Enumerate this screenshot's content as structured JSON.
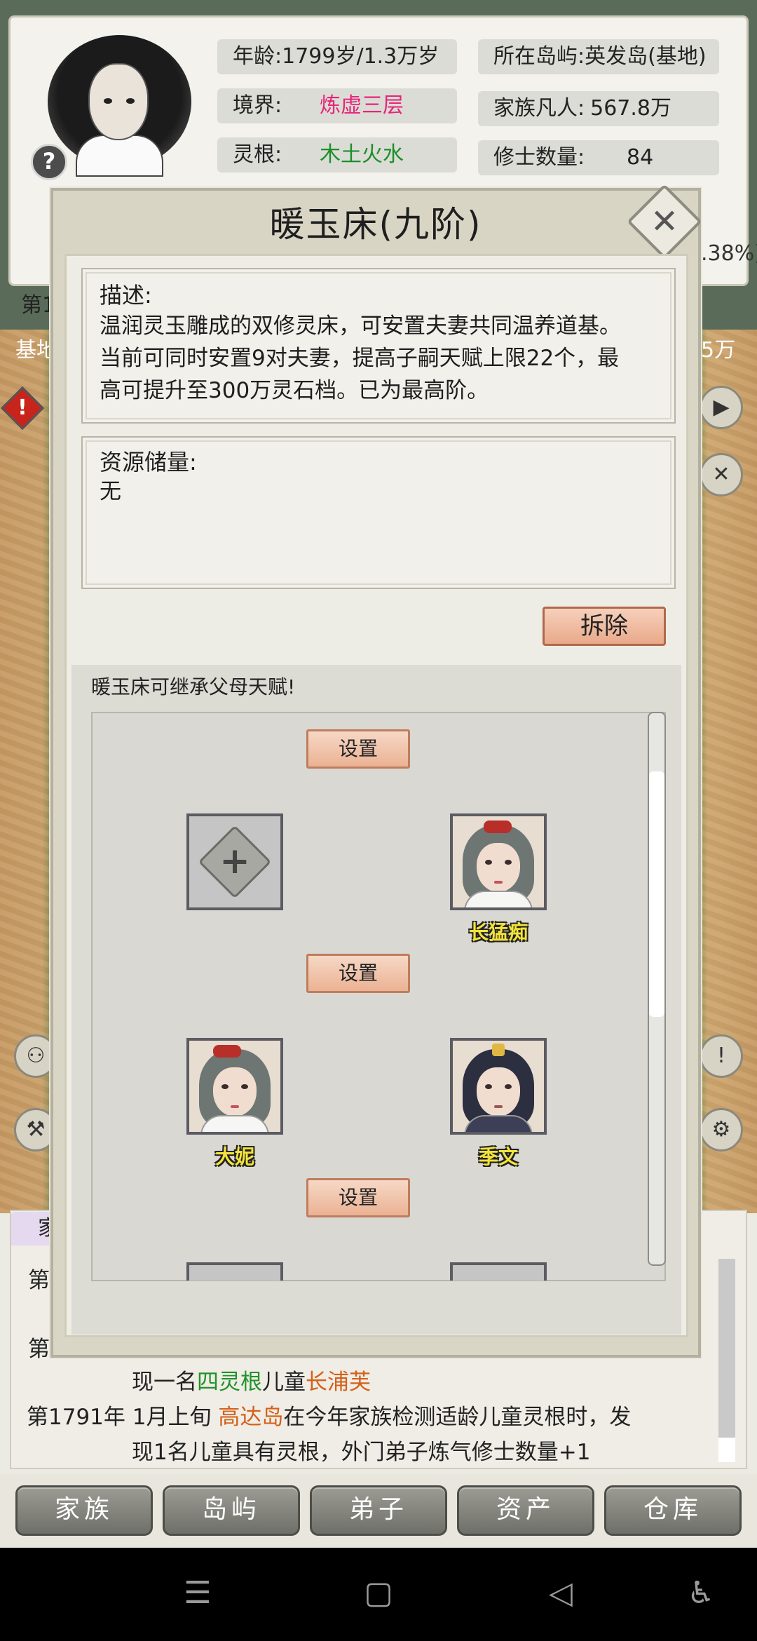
{
  "top_stats": {
    "age_label": "年龄:",
    "age_value": "1799岁/1.3万岁",
    "island_label": "所在岛屿:",
    "island_value": "英发岛(基地)",
    "realm_label": "境界:",
    "realm_value": "炼虚三层",
    "mortals_label": "家族凡人:",
    "mortals_value": "567.8万",
    "root_label": "灵根:",
    "root_value": "木土火水",
    "cultivators_label": "修士数量:",
    "cultivators_value": "84",
    "help_badge": "?"
  },
  "edge_fragments": {
    "left_di": "第1",
    "left_ji": "基地",
    "right_percent": ".38%)",
    "right_wan": "5万",
    "log_tab": "家",
    "log_di1": "第",
    "log_di2": "第"
  },
  "dialog": {
    "title": "暖玉床(九阶)",
    "close_symbol": "✕",
    "desc_label": "描述:",
    "desc_lines": [
      "温润灵玉雕成的双修灵床，可安置夫妻共同温养道基。",
      "当前可同时安置9对夫妻，提高子嗣天赋上限22个，最",
      "高可提升至300万灵石档。已为最高阶。"
    ],
    "resource_label": "资源储量:",
    "resource_value": "无",
    "remove_button": "拆除",
    "inherit_text": "暖玉床可继承父母天赋!",
    "set_button": "设置",
    "pairs": [
      {
        "left_name": "",
        "right_name": "长猛痴"
      },
      {
        "left_name": "大妮",
        "right_name": "季文"
      }
    ],
    "add_symbol": "+"
  },
  "log": {
    "line1_prefix": "现一名",
    "line1_root": "四灵根",
    "line1_mid": "儿童",
    "line1_name": "长浦芙",
    "line2_date": "第1791年 1月上旬",
    "line2_island": "高达岛",
    "line2_rest": "在今年家族检测适龄儿童灵根时，发",
    "line3": "现1名儿童具有灵根，外门弟子炼气修士数量+1"
  },
  "nav": {
    "items": [
      "家族",
      "岛屿",
      "弟子",
      "资产",
      "仓库"
    ]
  },
  "colors": {
    "realm": "#e6257a",
    "root": "#1b8f2a",
    "log_orange": "#d4601a",
    "log_green": "#21922a",
    "name_yellow": "#f3e33b",
    "button_peach": "#ebb294"
  },
  "icons": {
    "system_bar": [
      "menu-icon",
      "home-square-icon",
      "back-triangle-icon",
      "accessibility-icon"
    ]
  }
}
